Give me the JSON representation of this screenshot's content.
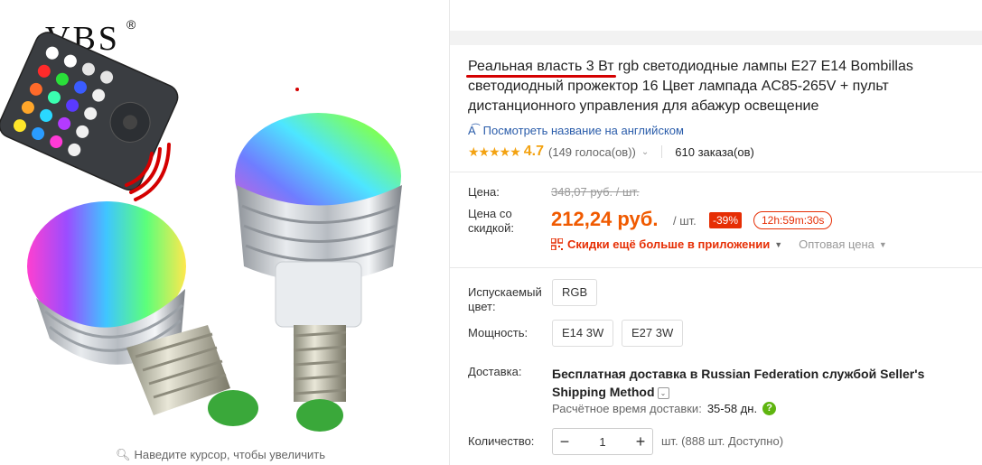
{
  "gallery": {
    "brand": "VBS",
    "brand_mark": "®",
    "zoom_hint": "Наведите курсор, чтобы увеличить"
  },
  "product": {
    "title_highlight": "Реальная власть 3 Вт",
    "title_rest": " rgb светодиодные лампы E27 E14 Bombillas светодиодный прожектор 16 Цвет лампада AC85-265V + пульт дистанционного управления для абажур освещение",
    "translate_link": "Посмотреть название на английском",
    "rating": "4.7",
    "stars": "★★★★★",
    "votes": "(149 голоса(ов))",
    "orders": "610 заказа(ов)"
  },
  "price": {
    "label": "Цена:",
    "original": "348,07 руб. / шт.",
    "discount_label": "Цена со скидкой:",
    "current": "212,24 руб.",
    "per_unit": "/ шт.",
    "discount_badge": "-39%",
    "timer": "12h:59m:30s",
    "app_promo": "Скидки ещё больше в приложении",
    "wholesale": "Оптовая цена"
  },
  "options": {
    "color_label": "Испускаемый цвет:",
    "color_values": [
      "RGB"
    ],
    "power_label": "Мощность:",
    "power_values": [
      "E14 3W",
      "E27 3W"
    ]
  },
  "shipping": {
    "label": "Доставка:",
    "free_prefix": "Бесплатная доставка в",
    "country": "Russian Federation",
    "service_prefix": "службой",
    "service": "Seller's Shipping Method",
    "est_label": "Расчётное время доставки:",
    "est_value": "35-58 дн."
  },
  "quantity": {
    "label": "Количество:",
    "value": "1",
    "minus": "−",
    "plus": "+",
    "available": "шт. (888 шт. Доступно)"
  },
  "colors": {
    "price_orange": "#f05a00",
    "discount_red": "#e62e04",
    "star_orange": "#f3a211",
    "link_blue": "#2a5caa"
  }
}
